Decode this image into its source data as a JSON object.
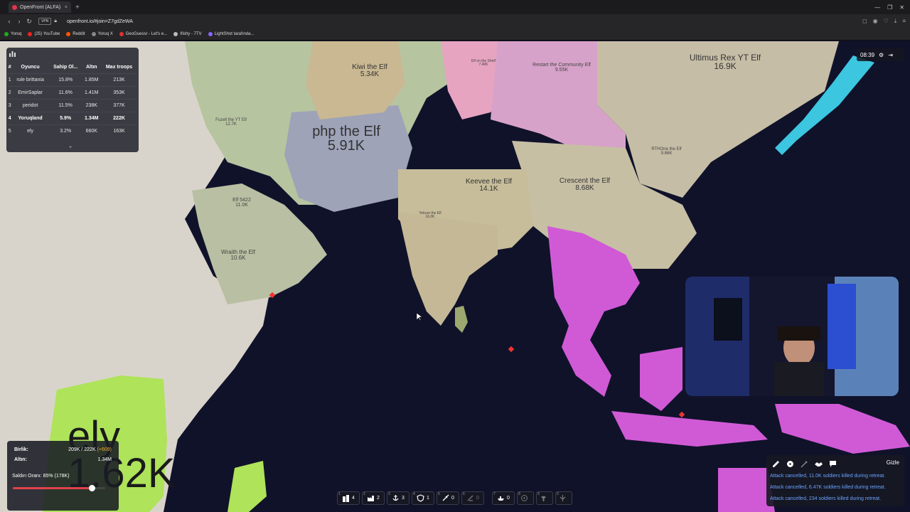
{
  "browser": {
    "tab_title": "OpenFront (ALFA)",
    "url": "openfront.io/#join=Z7gdZeWA",
    "vpn": "VPN",
    "bookmarks": [
      "Yoruq",
      "(25) YouTube",
      "Reddit",
      "Yoruq X",
      "GeoGuessr - Let's e...",
      "Ifishy - 7TV",
      "LightShot tarafında..."
    ]
  },
  "leaderboard": {
    "headers": [
      "#",
      "Oyuncu",
      "Sahip Ol...",
      "Altın",
      "Max troops"
    ],
    "rows": [
      {
        "rank": "1",
        "player": "rule brittania",
        "owned": "15.8%",
        "gold": "1.85M",
        "troops": "213K"
      },
      {
        "rank": "2",
        "player": "EmirSaplar",
        "owned": "11.6%",
        "gold": "1.41M",
        "troops": "353K"
      },
      {
        "rank": "3",
        "player": "peridot",
        "owned": "11.5%",
        "gold": "238K",
        "troops": "377K"
      },
      {
        "rank": "4",
        "player": "Yoruqland",
        "owned": "5.9%",
        "gold": "1.34M",
        "troops": "222K"
      },
      {
        "rank": "5",
        "player": "ely",
        "owned": "3.2%",
        "gold": "660K",
        "troops": "163K"
      }
    ],
    "more": "+"
  },
  "timer": "08:39",
  "territories": [
    {
      "name": "Kiwi the Elf",
      "troops": "5.34K"
    },
    {
      "name": "Elf on the Shelf",
      "troops": "7.40K"
    },
    {
      "name": "Restart the Community Elf",
      "troops": "9.55K"
    },
    {
      "name": "Ultimus Rex YT Elf",
      "troops": "16.9K"
    },
    {
      "name": "php the Elf",
      "troops": "5.91K"
    },
    {
      "name": "Fuzell the YT Elf",
      "troops": "12.7K"
    },
    {
      "name": "Keevee the Elf",
      "troops": "14.1K"
    },
    {
      "name": "Crescent the Elf",
      "troops": "8.68K"
    },
    {
      "name": "RTHOne the Elf",
      "troops": "9.86K"
    },
    {
      "name": "Elf 5422",
      "troops": "11.0K"
    },
    {
      "name": "Wraith the Elf",
      "troops": "10.6K"
    },
    {
      "name": "Yebure the Elf",
      "troops": "16.0K"
    },
    {
      "name": "ely",
      "troops": "1.62K"
    }
  ],
  "stats": {
    "troops_label": "Birlik:",
    "troops_value": "209K / 222K",
    "troops_gain": "(+609)",
    "gold_label": "Altın:",
    "gold_value": "1.34M",
    "attack_label": "Saldırı Oranı: 85% (178K)",
    "attack_ratio": 0.85
  },
  "buildbar": [
    {
      "key": "1",
      "icon": "city-icon",
      "count": "4"
    },
    {
      "key": "2",
      "icon": "factory-icon",
      "count": "2"
    },
    {
      "key": "3",
      "icon": "port-icon",
      "count": "3"
    },
    {
      "key": "4",
      "icon": "defense-post-icon",
      "count": "1"
    },
    {
      "key": "5",
      "icon": "missile-silo-icon",
      "count": "0"
    },
    {
      "key": "6",
      "icon": "sam-launcher-icon",
      "count": "0"
    },
    {
      "key": "7",
      "icon": "warship-icon",
      "count": "0"
    },
    {
      "key": "8",
      "icon": "atom-bomb-icon",
      "count": ""
    },
    {
      "key": "9",
      "icon": "hydrogen-bomb-icon",
      "count": ""
    },
    {
      "key": "0",
      "icon": "mirv-icon",
      "count": ""
    }
  ],
  "events": {
    "hide_label": "Gizle",
    "messages": [
      "Attack cancelled, 11.0K soldiers killed during retreat.",
      "Attack cancelled, 6.47K soldiers killed during retreat.",
      "Attack cancelled, 234 soldiers killed during retreat."
    ]
  }
}
